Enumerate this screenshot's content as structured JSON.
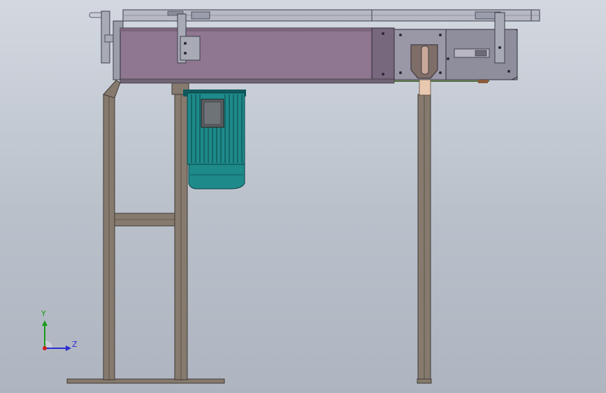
{
  "viewport": {
    "background_top": "#d3d8e0",
    "background_bottom": "#aeb5c0"
  },
  "colors": {
    "frame_steel": "#867a6e",
    "frame_edge": "#3f3a35",
    "conveyor_body": "#8f7791",
    "conveyor_end_plate": "#77687d",
    "side_plate": "#9a98a6",
    "motor_teal": "#1e8a8a",
    "motor_dark": "#0f5a5c",
    "top_rail": "#b6b9c4",
    "foot_pad": "#e8c9b0"
  },
  "triad": {
    "y_label": "Y",
    "z_label": "Z",
    "y_color": "#1a9a1a",
    "z_color": "#2c2cd0",
    "origin_color": "#d02020"
  }
}
